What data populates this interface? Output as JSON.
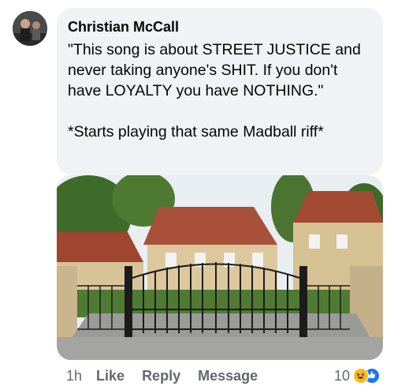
{
  "comment": {
    "author": "Christian McCall",
    "text": "\"This song is about STREET JUSTICE and never taking anyone's SHIT. If you don't have LOYALTY you have NOTHING.\"\n\n*Starts playing that same Madball riff*"
  },
  "actions": {
    "time": "1h",
    "like_label": "Like",
    "reply_label": "Reply",
    "message_label": "Message",
    "reaction_count": "10",
    "reactions": [
      "haha-icon",
      "like-icon"
    ]
  },
  "colors": {
    "bubble": "#f0f2f5",
    "muted_text": "#65676b",
    "like_blue": "#1877f2",
    "haha_yellow": "#f7b928"
  }
}
